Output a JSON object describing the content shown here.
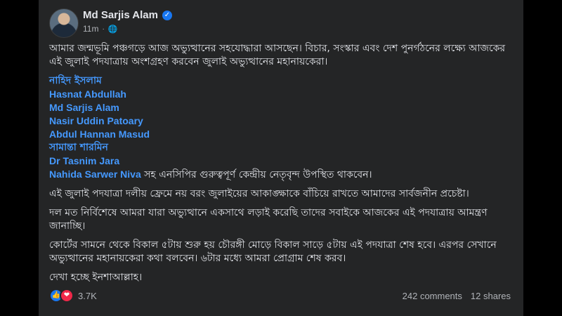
{
  "post": {
    "author": "Md Sarjis Alam",
    "time": "11m",
    "separator": "·",
    "paragraphs": {
      "p1": "আমার জন্মভূমি পঞ্চগড়ে আজ অভ্যুত্থানের সহযোদ্ধারা আসছেন। বিচার, সংস্কার এবং দেশ পুনর্গঠনের লক্ষ্যে আজকের এই জুলাই পদযাত্রায় অংশগ্রহণ করবেন জুলাই অভ্যুত্থানের মহানায়কেরা।",
      "names": [
        "নাহিদ ইসলাম",
        "Hasnat Abdullah",
        "Md Sarjis Alam",
        "Nasir Uddin Patoary",
        "Abdul Hannan Masud",
        "সামান্তা শারমিন",
        "Dr Tasnim Jara"
      ],
      "last_name": "Nahida Sarwer Niva",
      "last_name_suffix": " সহ এনসিপির গুরুত্বপূর্ণ কেন্দ্রীয় নেতৃবৃন্দ উপস্থিত থাকবেন।",
      "p2": "এই জুলাই পদযাত্রা দলীয় ফ্রেমে নয় বরং জুলাইয়ের আকাঙ্ক্ষাকে বাঁচিয়ে রাখতে আমাদের সার্বজনীন প্রচেষ্টা।",
      "p3": "দল মত নির্বিশেষে আমরা যারা অভ্যুত্থানে একসাথে লড়াই করেছি তাদের সবাইকে আজকের এই পদযাত্রায় আমন্ত্রণ জানাচ্ছি।",
      "p4": "কোর্টের সামনে থেকে বিকাল ৫টায় শুরু হয় চৌরঙ্গী মোড়ে বিকাল সাড়ে ৫টায় এই পদযাত্রা শেষ হবে। এরপর সেখানে অভ্যুত্থানের মহানায়কেরা কথা বলবেন। ৬টার মধ্যে আমরা প্রোগ্রাম শেষ করব।",
      "p5": "দেখা হচ্ছে ইনশাআল্লাহ।"
    },
    "reactions_count": "3.7K",
    "comments": "242 comments",
    "shares": "12 shares"
  },
  "icons": {
    "verified": "verified-badge-icon",
    "audience": "globe-icon",
    "like": "like-icon",
    "love": "love-icon"
  },
  "colors": {
    "background": "#242526",
    "text": "#e4e6eb",
    "link": "#4599ff",
    "like": "#1877f2",
    "love": "#f02849"
  }
}
